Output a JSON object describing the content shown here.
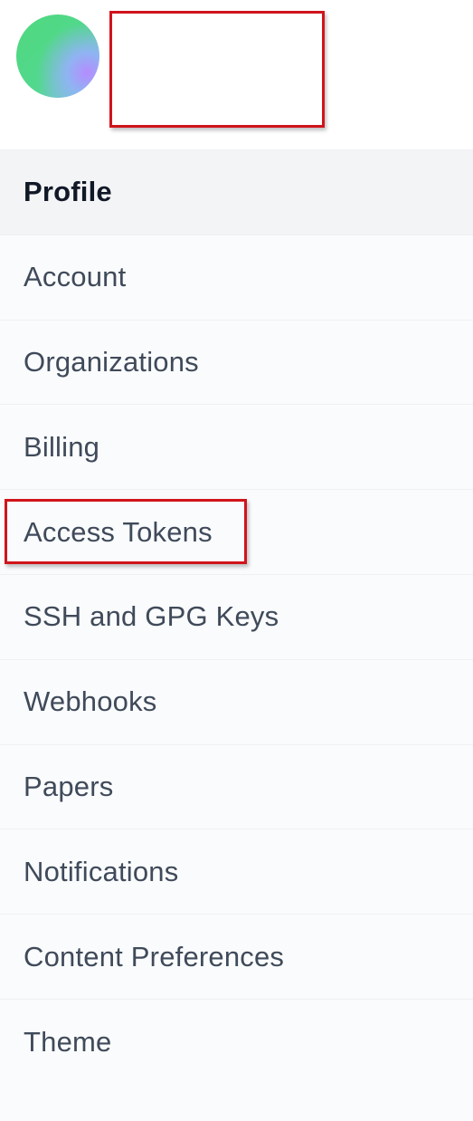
{
  "user": {
    "avatar": "gradient-avatar-icon"
  },
  "annotation_color": "#d0141c",
  "sidebar": {
    "items": [
      {
        "label": "Profile",
        "active": true
      },
      {
        "label": "Account"
      },
      {
        "label": "Organizations"
      },
      {
        "label": "Billing"
      },
      {
        "label": "Access Tokens",
        "highlighted": true
      },
      {
        "label": "SSH and GPG Keys"
      },
      {
        "label": "Webhooks"
      },
      {
        "label": "Papers"
      },
      {
        "label": "Notifications"
      },
      {
        "label": "Content Preferences"
      },
      {
        "label": "Theme"
      }
    ]
  }
}
